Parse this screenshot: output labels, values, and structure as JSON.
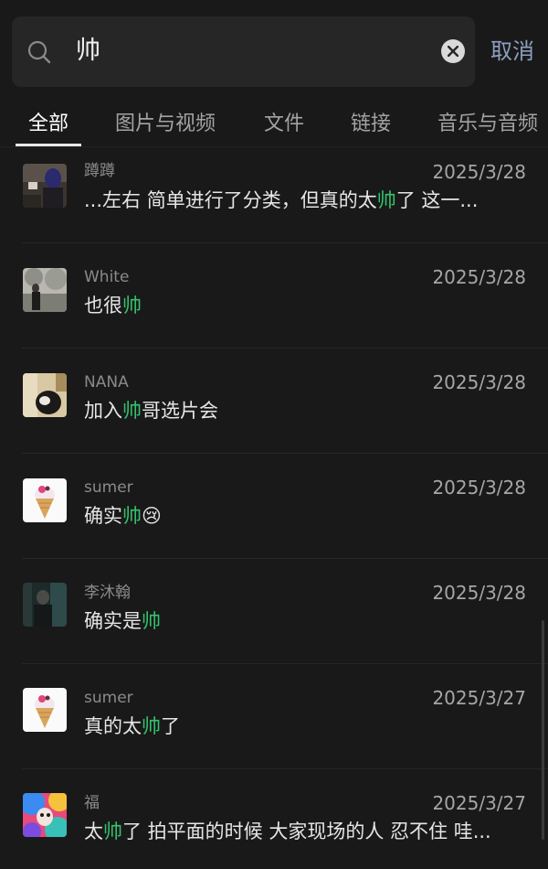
{
  "search": {
    "query": "帅",
    "cancel_label": "取消"
  },
  "tabs": [
    {
      "label": "全部",
      "active": true
    },
    {
      "label": "图片与视频",
      "active": false
    },
    {
      "label": "文件",
      "active": false
    },
    {
      "label": "链接",
      "active": false
    },
    {
      "label": "音乐与音频",
      "active": false
    }
  ],
  "colors": {
    "background": "#191919",
    "highlight": "#33c26d",
    "cancel": "#8e9fc1"
  },
  "results": [
    {
      "name": "蹲蹲",
      "date": "2025/3/28",
      "msg_before": "...左右 简单进行了分类，但真的太",
      "msg_hl": "帅",
      "msg_after": "了 这一..."
    },
    {
      "name": "White",
      "date": "2025/3/28",
      "msg_before": "也很",
      "msg_hl": "帅",
      "msg_after": ""
    },
    {
      "name": "NANA",
      "date": "2025/3/28",
      "msg_before": "加入",
      "msg_hl": "帅",
      "msg_after": "哥选片会"
    },
    {
      "name": "sumer",
      "date": "2025/3/28",
      "msg_before": "确实",
      "msg_hl": "帅",
      "msg_after": "😢"
    },
    {
      "name": "李沐翰",
      "date": "2025/3/28",
      "msg_before": "确实是",
      "msg_hl": "帅",
      "msg_after": ""
    },
    {
      "name": "sumer",
      "date": "2025/3/27",
      "msg_before": "真的太",
      "msg_hl": "帅",
      "msg_after": "了"
    },
    {
      "name": "福",
      "date": "2025/3/27",
      "msg_before": "太",
      "msg_hl": "帅",
      "msg_after": "了 拍平面的时候 大家现场的人 忍不住 哇..."
    }
  ]
}
